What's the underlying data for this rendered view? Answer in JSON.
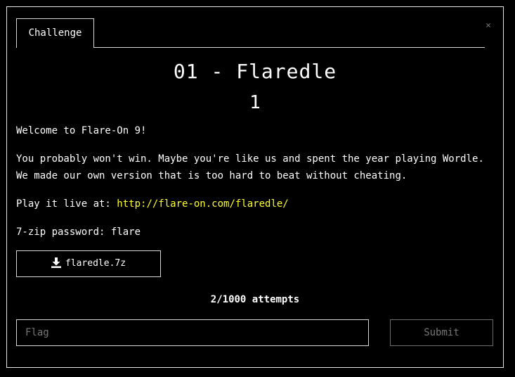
{
  "tabs": [
    {
      "label": "Challenge",
      "active": true
    }
  ],
  "close_icon": "close-icon",
  "challenge": {
    "title": "01 - Flaredle",
    "points": "1",
    "welcome": "Welcome to Flare-On 9!",
    "description": "You probably won't win. Maybe you're like us and spent the year playing Wordle. We made our own version that is too hard to beat without cheating.",
    "play_prefix": "Play it live at: ",
    "play_link": "http://flare-on.com/flaredle/",
    "zip_password": "7-zip password: flare"
  },
  "file": {
    "label": "flaredle.7z",
    "icon": "download-icon"
  },
  "attempts": "2/1000 attempts",
  "flag_input": {
    "placeholder": "Flag",
    "value": ""
  },
  "submit_label": "Submit",
  "colors": {
    "background": "#000000",
    "text": "#ffffff",
    "link": "#ffff28",
    "border": "#d8d8d8",
    "muted": "#777777"
  }
}
